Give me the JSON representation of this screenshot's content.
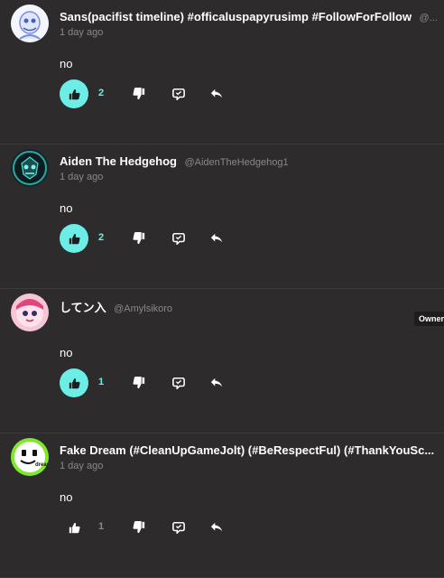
{
  "comments": [
    {
      "display_name": "Sans(pacifist timeline) #officaluspapyrusimp #FollowForFollow",
      "username": "@...",
      "time": "1 day ago",
      "body": "no",
      "likes": "2",
      "liked": true,
      "badge": ""
    },
    {
      "display_name": "Aiden The Hedgehog",
      "username": "@AidenTheHedgehog1",
      "time": "1 day ago",
      "body": "no",
      "likes": "2",
      "liked": true,
      "badge": ""
    },
    {
      "display_name": "してン入",
      "username": "@Amylsikoro",
      "time": "",
      "body": "no",
      "likes": "1",
      "liked": true,
      "badge": "Owner"
    },
    {
      "display_name": "Fake Dream (#CleanUpGameJolt) (#BeRespectFul) (#ThankYouSc...",
      "username": "",
      "time": "1 day ago",
      "body": "no",
      "likes": "1",
      "liked": false,
      "badge": "",
      "avatar_text": "dream"
    }
  ],
  "colors": {
    "accent": "#6ceee7",
    "background": "#2d2b2c",
    "muted": "#8a8888"
  },
  "icons": {
    "like": "thumbs-up-icon",
    "dislike": "thumbs-down-icon",
    "reply": "reply-bubble-icon",
    "share": "share-arrow-icon"
  }
}
